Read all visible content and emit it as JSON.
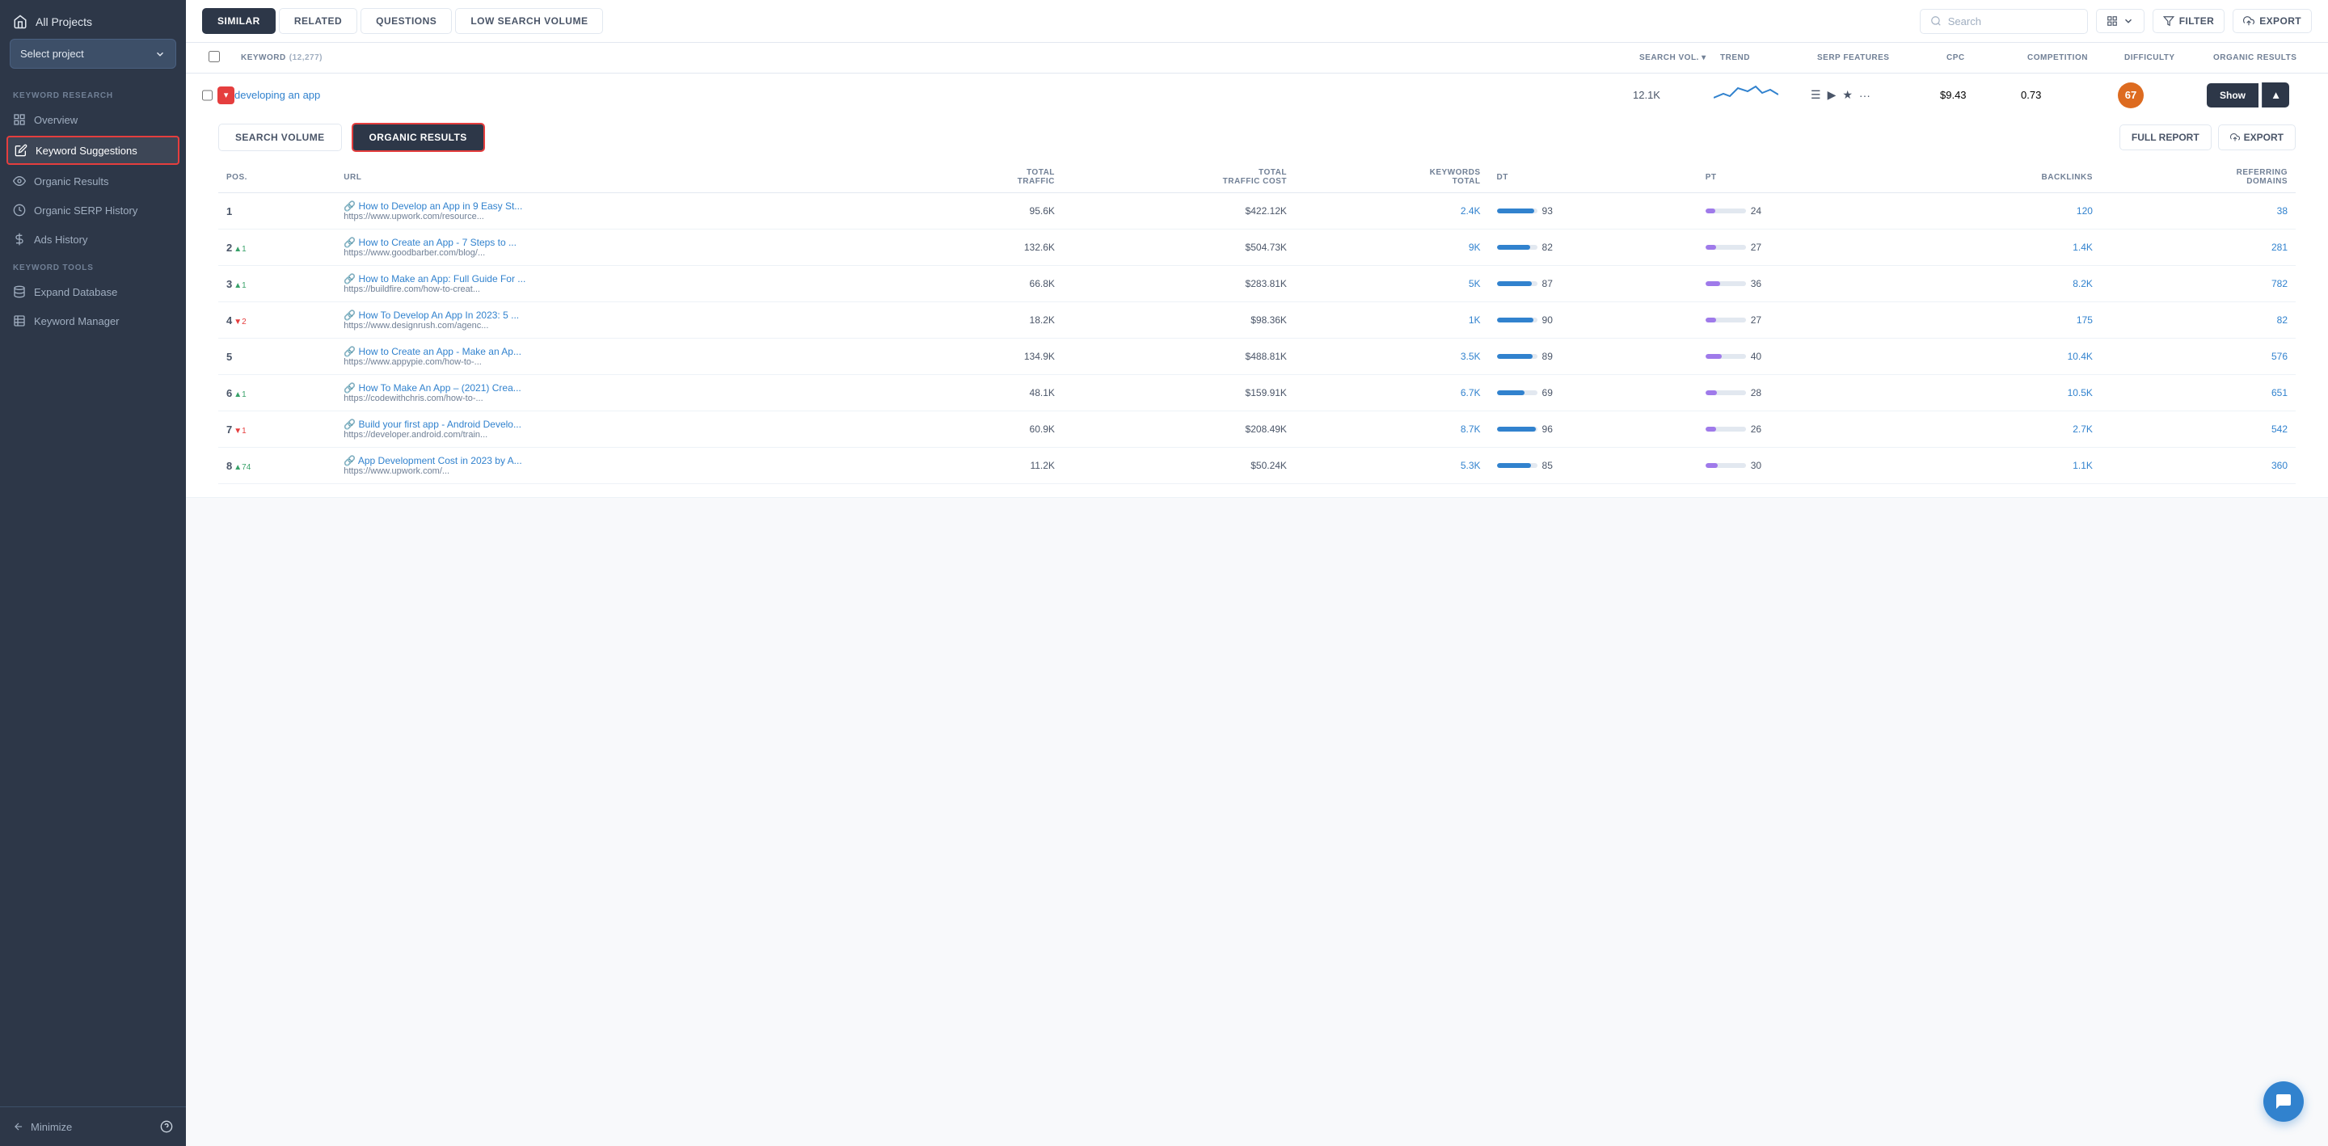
{
  "sidebar": {
    "all_projects_label": "All Projects",
    "select_project_placeholder": "Select project",
    "sections": [
      {
        "label": "KEYWORD RESEARCH",
        "items": [
          {
            "id": "overview",
            "label": "Overview",
            "icon": "grid"
          },
          {
            "id": "keyword-suggestions",
            "label": "Keyword Suggestions",
            "icon": "edit",
            "active": true,
            "highlighted": true
          },
          {
            "id": "organic-results",
            "label": "Organic Results",
            "icon": "eye"
          },
          {
            "id": "organic-serp-history",
            "label": "Organic SERP History",
            "icon": "clock"
          },
          {
            "id": "ads-history",
            "label": "Ads History",
            "icon": "dollar"
          }
        ]
      },
      {
        "label": "KEYWORD TOOLS",
        "items": [
          {
            "id": "expand-database",
            "label": "Expand Database",
            "icon": "database"
          },
          {
            "id": "keyword-manager",
            "label": "Keyword Manager",
            "icon": "table"
          }
        ]
      }
    ],
    "minimize_label": "Minimize"
  },
  "toolbar": {
    "tabs": [
      {
        "id": "similar",
        "label": "SIMILAR",
        "active": true
      },
      {
        "id": "related",
        "label": "RELATED",
        "active": false
      },
      {
        "id": "questions",
        "label": "QUESTIONS",
        "active": false
      },
      {
        "id": "low-search-volume",
        "label": "LOW SEARCH VOLUME",
        "active": false
      }
    ],
    "search_placeholder": "Search",
    "filter_label": "FILTER",
    "export_label": "EXPORT"
  },
  "table": {
    "columns": [
      {
        "id": "keyword",
        "label": "KEYWORD",
        "count": "12,277"
      },
      {
        "id": "search-vol",
        "label": "SEARCH VOL.",
        "sortable": true
      },
      {
        "id": "trend",
        "label": "TREND"
      },
      {
        "id": "serp-features",
        "label": "SERP FEATURES"
      },
      {
        "id": "cpc",
        "label": "CPC"
      },
      {
        "id": "competition",
        "label": "COMPETITION"
      },
      {
        "id": "difficulty",
        "label": "DIFFICULTY"
      },
      {
        "id": "organic-results",
        "label": "ORGANIC RESULTS"
      }
    ],
    "keyword_row": {
      "keyword": "developing an app",
      "search_vol": "12.1K",
      "cpc": "$9.43",
      "competition": "0.73",
      "difficulty": "67",
      "serp_features": [
        "list",
        "video",
        "star",
        "more"
      ]
    }
  },
  "expanded": {
    "tabs": [
      {
        "id": "search-volume",
        "label": "SEARCH VOLUME"
      },
      {
        "id": "organic-results",
        "label": "ORGANIC RESULTS",
        "active": true,
        "highlighted": true
      }
    ],
    "full_report_label": "FULL REPORT",
    "export_label": "EXPORT",
    "columns": [
      "POS.",
      "URL",
      "TOTAL TRAFFIC",
      "TOTAL TRAFFIC COST",
      "KEYWORDS TOTAL",
      "DT",
      "PT",
      "BACKLINKS",
      "REFERRING DOMAINS"
    ],
    "rows": [
      {
        "pos": "1",
        "pos_change": "",
        "pos_dir": "",
        "url_title": "How to Develop an App in 9 Easy St...",
        "url_sub": "https://www.upwork.com/resource...",
        "total_traffic": "95.6K",
        "total_traffic_cost": "$422.12K",
        "keywords_total": "2.4K",
        "dt": "93",
        "dt_pct": 93,
        "pt": "24",
        "pt_pct": 24,
        "backlinks": "120",
        "referring_domains": "38"
      },
      {
        "pos": "2",
        "pos_change": "▲1",
        "pos_dir": "up",
        "url_title": "How to Create an App - 7 Steps to ...",
        "url_sub": "https://www.goodbarber.com/blog/...",
        "total_traffic": "132.6K",
        "total_traffic_cost": "$504.73K",
        "keywords_total": "9K",
        "dt": "82",
        "dt_pct": 82,
        "pt": "27",
        "pt_pct": 27,
        "backlinks": "1.4K",
        "referring_domains": "281"
      },
      {
        "pos": "3",
        "pos_change": "▲1",
        "pos_dir": "up",
        "url_title": "How to Make an App: Full Guide For ...",
        "url_sub": "https://buildfire.com/how-to-creat...",
        "total_traffic": "66.8K",
        "total_traffic_cost": "$283.81K",
        "keywords_total": "5K",
        "dt": "87",
        "dt_pct": 87,
        "pt": "36",
        "pt_pct": 36,
        "backlinks": "8.2K",
        "referring_domains": "782"
      },
      {
        "pos": "4",
        "pos_change": "▼2",
        "pos_dir": "down",
        "url_title": "How To Develop An App In 2023: 5 ...",
        "url_sub": "https://www.designrush.com/agenc...",
        "total_traffic": "18.2K",
        "total_traffic_cost": "$98.36K",
        "keywords_total": "1K",
        "dt": "90",
        "dt_pct": 90,
        "pt": "27",
        "pt_pct": 27,
        "backlinks": "175",
        "referring_domains": "82"
      },
      {
        "pos": "5",
        "pos_change": "",
        "pos_dir": "",
        "url_title": "How to Create an App - Make an Ap...",
        "url_sub": "https://www.appypie.com/how-to-...",
        "total_traffic": "134.9K",
        "total_traffic_cost": "$488.81K",
        "keywords_total": "3.5K",
        "dt": "89",
        "dt_pct": 89,
        "pt": "40",
        "pt_pct": 40,
        "backlinks": "10.4K",
        "referring_domains": "576"
      },
      {
        "pos": "6",
        "pos_change": "▲1",
        "pos_dir": "up",
        "url_title": "How To Make An App – (2021) Crea...",
        "url_sub": "https://codewithchris.com/how-to-...",
        "total_traffic": "48.1K",
        "total_traffic_cost": "$159.91K",
        "keywords_total": "6.7K",
        "dt": "69",
        "dt_pct": 69,
        "pt": "28",
        "pt_pct": 28,
        "backlinks": "10.5K",
        "referring_domains": "651"
      },
      {
        "pos": "7",
        "pos_change": "▼1",
        "pos_dir": "down",
        "url_title": "Build your first app - Android Develo...",
        "url_sub": "https://developer.android.com/train...",
        "total_traffic": "60.9K",
        "total_traffic_cost": "$208.49K",
        "keywords_total": "8.7K",
        "dt": "96",
        "dt_pct": 96,
        "pt": "26",
        "pt_pct": 26,
        "backlinks": "2.7K",
        "referring_domains": "542"
      },
      {
        "pos": "8",
        "pos_change": "▲74",
        "pos_dir": "up",
        "url_title": "App Development Cost in 2023 by A...",
        "url_sub": "https://www.upwork.com/...",
        "total_traffic": "11.2K",
        "total_traffic_cost": "$50.24K",
        "keywords_total": "5.3K",
        "dt": "85",
        "dt_pct": 85,
        "pt": "30",
        "pt_pct": 30,
        "backlinks": "1.1K",
        "referring_domains": "360"
      }
    ]
  }
}
